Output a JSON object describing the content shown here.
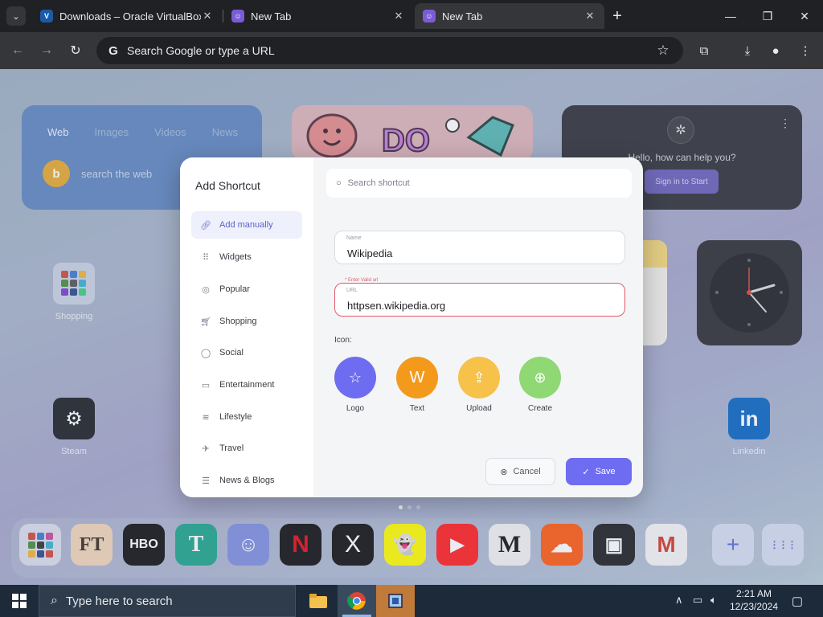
{
  "browser": {
    "tabs": [
      {
        "title": "Downloads – Oracle VirtualBox",
        "favicon": "virtualbox-icon",
        "active": false
      },
      {
        "title": "New Tab",
        "favicon": "newtab-extension-icon",
        "active": false
      },
      {
        "title": "New Tab",
        "favicon": "newtab-extension-icon",
        "active": true
      }
    ],
    "omnibox_placeholder": "Search Google or type a URL"
  },
  "background": {
    "search_widget": {
      "tabs": [
        "Web",
        "Images",
        "Videos",
        "News"
      ],
      "placeholder": "search the web"
    },
    "ai_widget": {
      "greeting": "Hello, how can help you?",
      "button": "Sign in to Start"
    },
    "apps": [
      {
        "label": "Shopping",
        "icon": "folder-icon"
      },
      {
        "label": "Steam",
        "icon": "steam-icon"
      },
      {
        "label": "Linkedin",
        "icon": "linkedin-icon"
      }
    ],
    "dock": [
      {
        "name": "folder",
        "glyph": ""
      },
      {
        "name": "ft",
        "glyph": "FT"
      },
      {
        "name": "hbo",
        "glyph": "HBO"
      },
      {
        "name": "telegraph",
        "glyph": "T"
      },
      {
        "name": "discord",
        "glyph": "☺"
      },
      {
        "name": "netflix",
        "glyph": "N"
      },
      {
        "name": "x",
        "glyph": "X"
      },
      {
        "name": "snapchat",
        "glyph": "👻"
      },
      {
        "name": "youtube",
        "glyph": "▶"
      },
      {
        "name": "medium",
        "glyph": "M"
      },
      {
        "name": "soundcloud",
        "glyph": "☁"
      },
      {
        "name": "twitch",
        "glyph": "▣"
      },
      {
        "name": "gmail",
        "glyph": "M"
      },
      {
        "name": "add",
        "glyph": "+"
      },
      {
        "name": "apps",
        "glyph": "⋮⋮⋮"
      }
    ]
  },
  "modal": {
    "title": "Add Shortcut",
    "search_placeholder": "Search shortcut",
    "categories": [
      {
        "label": "Add manually",
        "icon": "link-icon",
        "selected": true
      },
      {
        "label": "Widgets",
        "icon": "grid-icon",
        "selected": false
      },
      {
        "label": "Popular",
        "icon": "popular-icon",
        "selected": false
      },
      {
        "label": "Shopping",
        "icon": "cart-icon",
        "selected": false
      },
      {
        "label": "Social",
        "icon": "chat-icon",
        "selected": false
      },
      {
        "label": "Entertainment",
        "icon": "monitor-icon",
        "selected": false
      },
      {
        "label": "Lifestyle",
        "icon": "lifestyle-icon",
        "selected": false
      },
      {
        "label": "Travel",
        "icon": "travel-icon",
        "selected": false
      },
      {
        "label": "News & Blogs",
        "icon": "news-icon",
        "selected": false
      }
    ],
    "name_field": {
      "label": "Name",
      "value": "Wikipedia"
    },
    "url_field": {
      "label": "URL",
      "value": "httpsen.wikipedia.org",
      "error": "* Enter Valid url"
    },
    "icon_label": "Icon:",
    "icon_options": [
      {
        "label": "Logo",
        "glyph": "☆",
        "color": "#6e6cf0"
      },
      {
        "label": "Text",
        "glyph": "W",
        "color": "#f39a1d"
      },
      {
        "label": "Upload",
        "glyph": "⇪",
        "color": "#f6c24a"
      },
      {
        "label": "Create",
        "glyph": "⊕",
        "color": "#8fd873"
      }
    ],
    "cancel_label": "Cancel",
    "save_label": "Save"
  },
  "taskbar": {
    "search_placeholder": "Type here to search",
    "time": "2:21 AM",
    "date": "12/23/2024"
  }
}
